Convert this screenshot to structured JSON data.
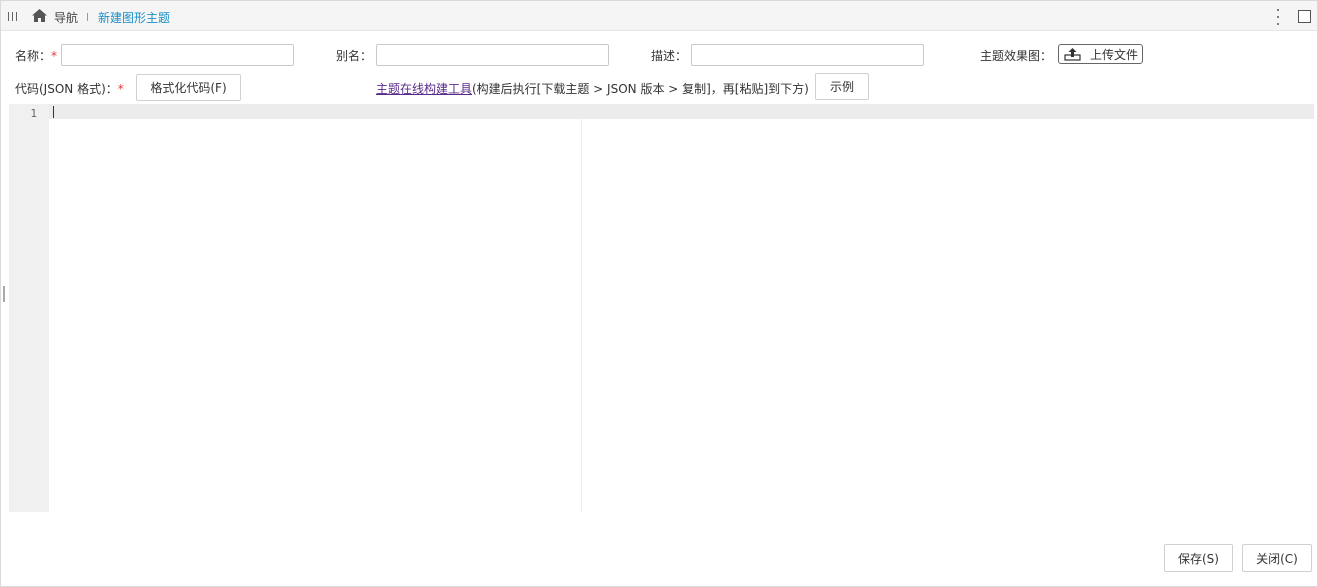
{
  "header": {
    "nav_label": "导航",
    "current_page": "新建图形主题",
    "icons": [
      "menu-toggle-icon",
      "home-icon",
      "more-vertical-icon",
      "maximize-icon"
    ]
  },
  "form": {
    "name": {
      "label": "名称：",
      "required_mark": "*",
      "value": ""
    },
    "alias": {
      "label": "别名：",
      "value": ""
    },
    "description": {
      "label": "描述：",
      "value": ""
    },
    "preview": {
      "label": "主题效果图：",
      "upload_label": "上传文件"
    },
    "code": {
      "label": "代码(JSON 格式)：",
      "required_mark": "*",
      "format_button": "格式化代码(F)",
      "link_text": "主题在线构建工具",
      "hint": "(构建后执行[下载主题 > JSON 版本 > 复制]，再[粘贴]到下方)",
      "example_button": "示例"
    }
  },
  "editor": {
    "line_numbers": [
      "1"
    ],
    "content": ""
  },
  "footer": {
    "save_label": "保存(S)",
    "close_label": "关闭(C)"
  },
  "colors": {
    "accent": "#1a8fc6",
    "required": "#e4393c",
    "link": "#5a2a8a",
    "header_bg": "#f5f5f5"
  }
}
